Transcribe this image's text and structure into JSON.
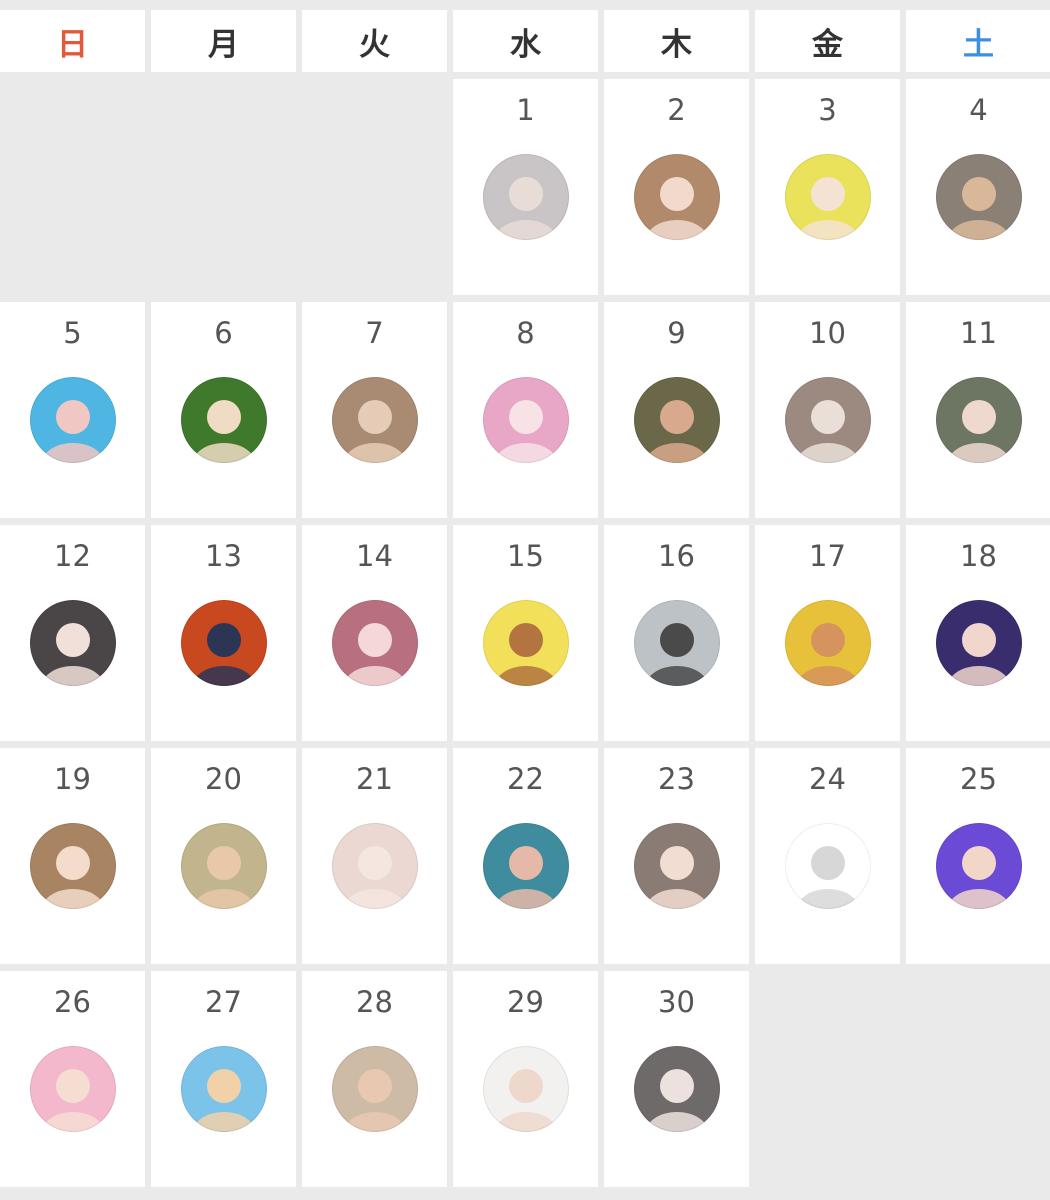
{
  "weekdays": [
    "日",
    "月",
    "火",
    "水",
    "木",
    "金",
    "土"
  ],
  "colors": {
    "sunday": "#e0593a",
    "saturday": "#3f8fe0",
    "weekday": "#333333",
    "day_number": "#555555",
    "empty_cell": "#ebeaea",
    "cell": "#ffffff"
  },
  "leading_blank_days": 3,
  "days": [
    {
      "day": "1",
      "avatar": {
        "icon": "profile-avatar-icon",
        "bg": "#c9c4c6",
        "fg": "#e8dcd6"
      }
    },
    {
      "day": "2",
      "avatar": {
        "icon": "profile-avatar-icon",
        "bg": "#b08a6a",
        "fg": "#f1d9cc"
      }
    },
    {
      "day": "3",
      "avatar": {
        "icon": "profile-avatar-icon",
        "bg": "#e9e25a",
        "fg": "#f4e3d2"
      }
    },
    {
      "day": "4",
      "avatar": {
        "icon": "profile-avatar-icon",
        "bg": "#8a8076",
        "fg": "#d9b89a"
      }
    },
    {
      "day": "5",
      "avatar": {
        "icon": "profile-avatar-icon",
        "bg": "#4fb6e3",
        "fg": "#f0c7c2"
      }
    },
    {
      "day": "6",
      "avatar": {
        "icon": "profile-avatar-icon",
        "bg": "#3f7a2c",
        "fg": "#f0dcc4"
      }
    },
    {
      "day": "7",
      "avatar": {
        "icon": "profile-avatar-icon",
        "bg": "#a98a72",
        "fg": "#e6cbb6"
      }
    },
    {
      "day": "8",
      "avatar": {
        "icon": "profile-avatar-icon",
        "bg": "#e8a7c6",
        "fg": "#f7e2e6"
      }
    },
    {
      "day": "9",
      "avatar": {
        "icon": "profile-avatar-icon",
        "bg": "#6a6848",
        "fg": "#d8a98c"
      }
    },
    {
      "day": "10",
      "avatar": {
        "icon": "profile-avatar-icon",
        "bg": "#9c8a80",
        "fg": "#e9dfd8"
      }
    },
    {
      "day": "11",
      "avatar": {
        "icon": "profile-avatar-icon",
        "bg": "#6d7563",
        "fg": "#efd9cf"
      }
    },
    {
      "day": "12",
      "avatar": {
        "icon": "profile-avatar-icon",
        "bg": "#4a4546",
        "fg": "#f1dfd9"
      }
    },
    {
      "day": "13",
      "avatar": {
        "icon": "profile-avatar-icon",
        "bg": "#c8481f",
        "fg": "#2d3557"
      }
    },
    {
      "day": "14",
      "avatar": {
        "icon": "profile-avatar-icon",
        "bg": "#b8707e",
        "fg": "#f4d8d8"
      }
    },
    {
      "day": "15",
      "avatar": {
        "icon": "profile-avatar-icon",
        "bg": "#f2df5a",
        "fg": "#b3743f"
      }
    },
    {
      "day": "16",
      "avatar": {
        "icon": "profile-avatar-icon",
        "bg": "#bcc2c6",
        "fg": "#4a4a4a"
      }
    },
    {
      "day": "17",
      "avatar": {
        "icon": "profile-avatar-icon",
        "bg": "#e8c13a",
        "fg": "#d6935e"
      }
    },
    {
      "day": "18",
      "avatar": {
        "icon": "profile-avatar-icon",
        "bg": "#3a2d6e",
        "fg": "#f0d6cc"
      }
    },
    {
      "day": "19",
      "avatar": {
        "icon": "profile-avatar-icon",
        "bg": "#a88462",
        "fg": "#f3dccc"
      }
    },
    {
      "day": "20",
      "avatar": {
        "icon": "profile-avatar-icon",
        "bg": "#c2b48c",
        "fg": "#e8c8a8"
      }
    },
    {
      "day": "21",
      "avatar": {
        "icon": "profile-avatar-icon",
        "bg": "#ecd8d2",
        "fg": "#f6e6e0"
      }
    },
    {
      "day": "22",
      "avatar": {
        "icon": "profile-avatar-icon",
        "bg": "#3e8c9e",
        "fg": "#e6b8a8"
      }
    },
    {
      "day": "23",
      "avatar": {
        "icon": "profile-avatar-icon",
        "bg": "#8a7c74",
        "fg": "#f2ddd2"
      }
    },
    {
      "day": "24",
      "avatar": {
        "icon": "profile-avatar-icon",
        "bg": "#ffffff",
        "fg": "#d7d7d7"
      }
    },
    {
      "day": "25",
      "avatar": {
        "icon": "profile-avatar-icon",
        "bg": "#6b4ad6",
        "fg": "#f2d7c9"
      }
    },
    {
      "day": "26",
      "avatar": {
        "icon": "profile-avatar-icon",
        "bg": "#f3b8cc",
        "fg": "#f6ddd2"
      }
    },
    {
      "day": "27",
      "avatar": {
        "icon": "profile-avatar-icon",
        "bg": "#7cc3ea",
        "fg": "#f2d1a8"
      }
    },
    {
      "day": "28",
      "avatar": {
        "icon": "profile-avatar-icon",
        "bg": "#cdbba6",
        "fg": "#e9c8b2"
      }
    },
    {
      "day": "29",
      "avatar": {
        "icon": "profile-avatar-icon",
        "bg": "#f2f1f0",
        "fg": "#eed8cc"
      }
    },
    {
      "day": "30",
      "avatar": {
        "icon": "profile-avatar-icon",
        "bg": "#6f6a6a",
        "fg": "#ece1de"
      }
    }
  ],
  "trailing_blank_days": 2
}
